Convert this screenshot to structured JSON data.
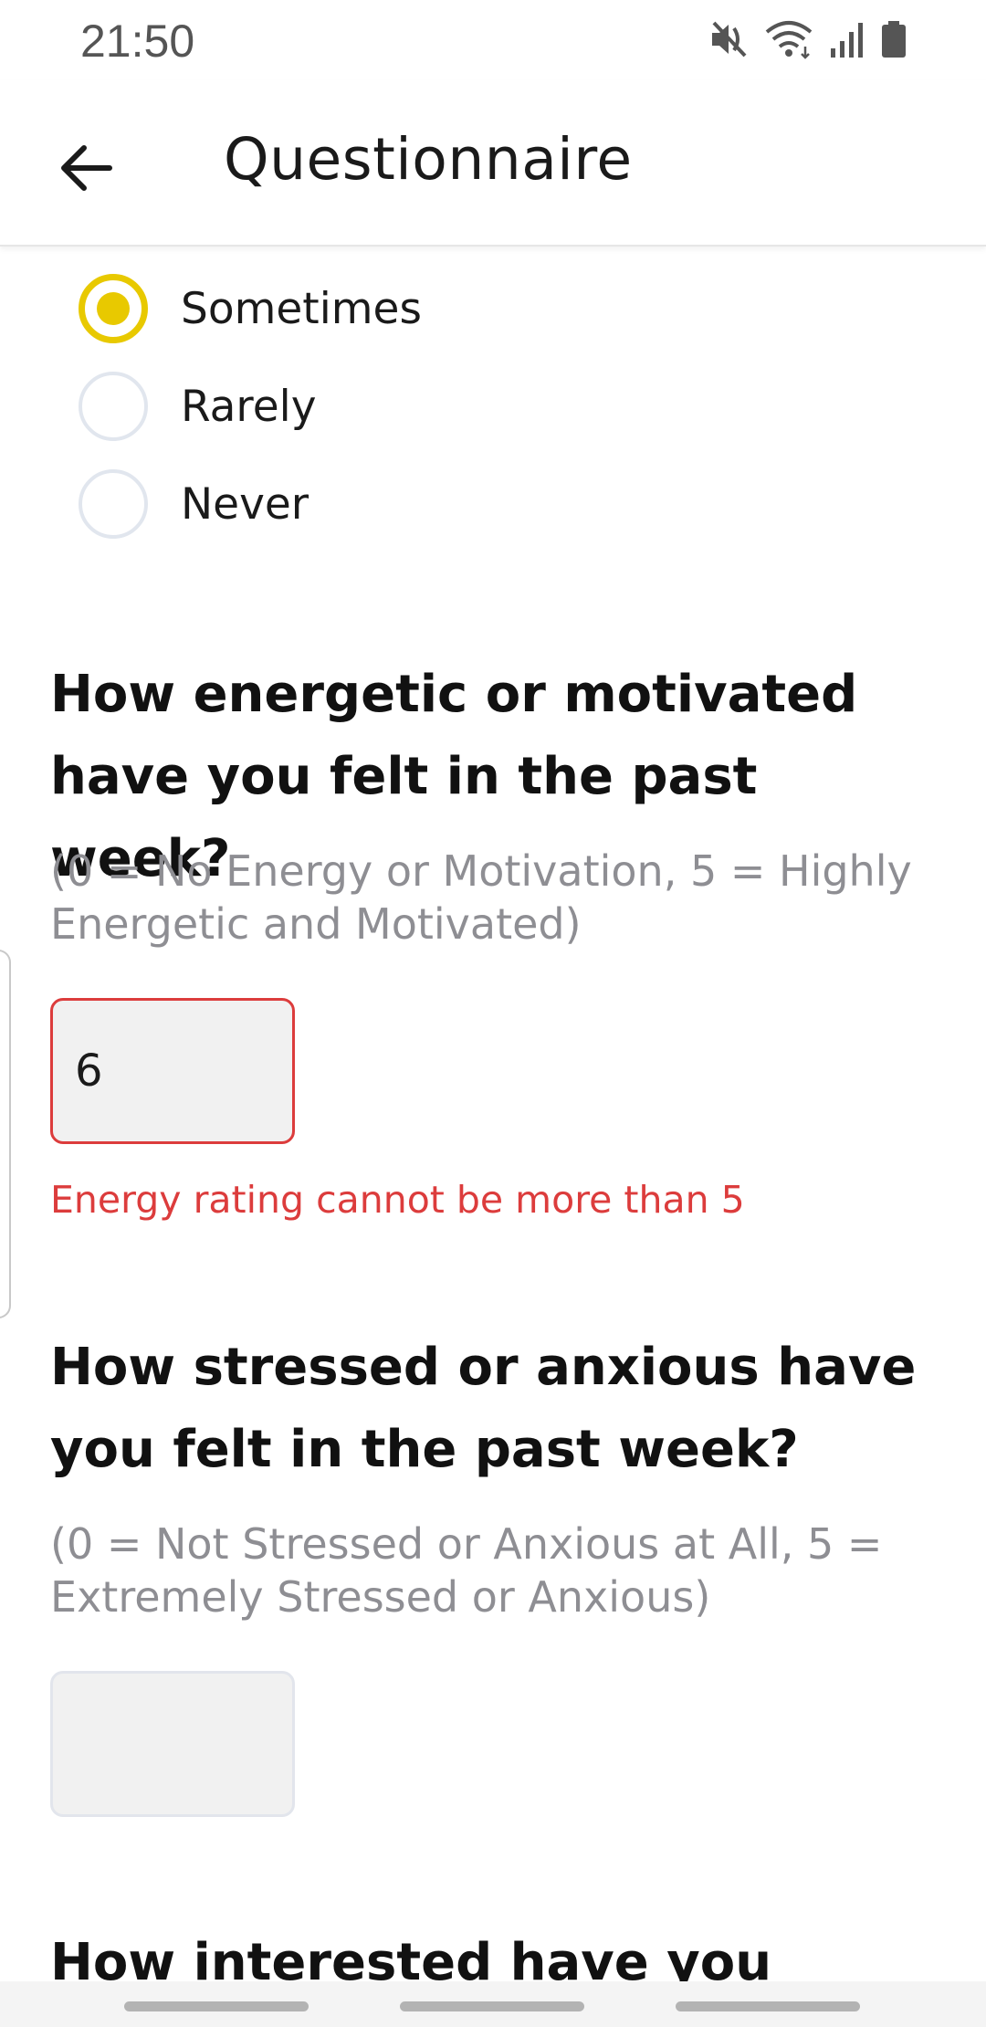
{
  "status_bar": {
    "time": "21:50",
    "icons": [
      "mute-icon",
      "wifi-icon",
      "signal-icon",
      "battery-icon"
    ]
  },
  "header": {
    "title": "Questionnaire",
    "back_icon": "arrow-left-icon"
  },
  "previous_question": {
    "options": [
      {
        "label": "Sometimes",
        "selected": true
      },
      {
        "label": "Rarely",
        "selected": false
      },
      {
        "label": "Never",
        "selected": false
      }
    ]
  },
  "questions": [
    {
      "title": "How energetic or motivated have you felt in the past week?",
      "hint": "(0 = No Energy or Motivation, 5 = Highly Energetic and Motivated)",
      "value": "6",
      "error": "Energy rating cannot be more than 5"
    },
    {
      "title": "How stressed or anxious have you felt in the past week?",
      "hint": "(0 = Not Stressed or Anxious at All, 5 = Extremely Stressed or Anxious)",
      "value": ""
    },
    {
      "title": "How interested have you been in"
    }
  ],
  "colors": {
    "accent": "#e8c900",
    "error": "#dc3c3c",
    "hint": "#8e8e93"
  }
}
